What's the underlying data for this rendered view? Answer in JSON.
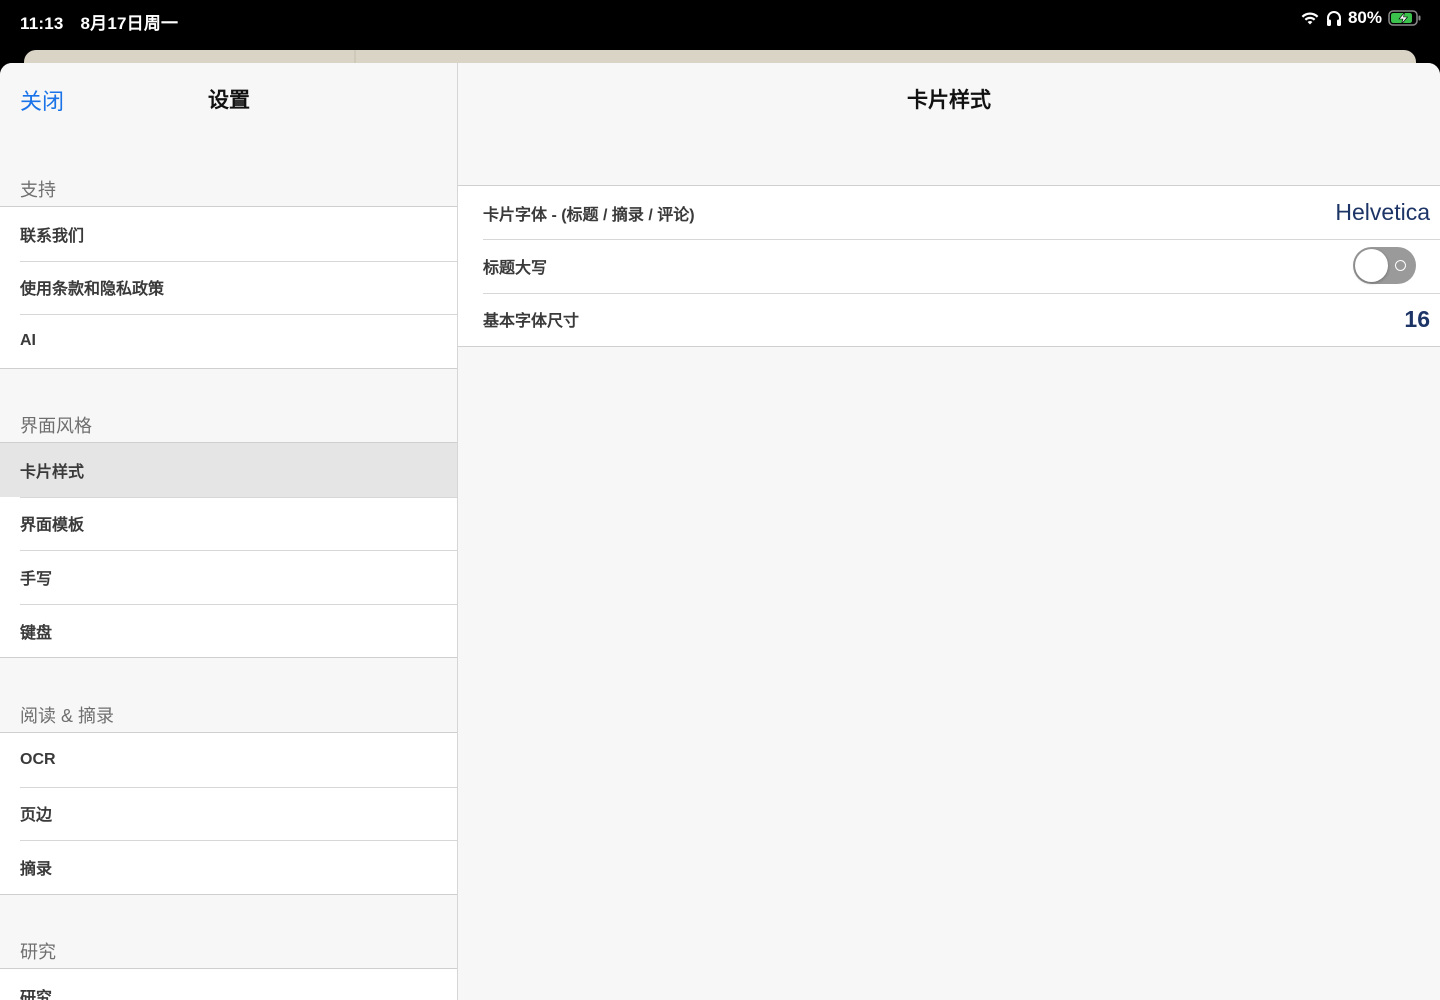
{
  "status_bar": {
    "time": "11:13",
    "date": "8月17日周一",
    "battery": "80%",
    "icons": [
      "wifi-icon",
      "headphones-icon",
      "battery-charging-icon"
    ]
  },
  "sidebar": {
    "close_label": "关闭",
    "title": "设置",
    "sections": [
      {
        "header": "支持",
        "items": [
          "联系我们",
          "使用条款和隐私政策",
          "AI"
        ]
      },
      {
        "header": "界面风格",
        "items": [
          "卡片样式",
          "界面模板",
          "手写",
          "键盘"
        ]
      },
      {
        "header": "阅读 & 摘录",
        "items": [
          "OCR",
          "页边",
          "摘录"
        ]
      },
      {
        "header": "研究",
        "items": [
          "研究"
        ]
      }
    ],
    "selected_item": "卡片样式"
  },
  "detail": {
    "title": "卡片样式",
    "rows": [
      {
        "label": "卡片字体 - (标题 / 摘录 / 评论)",
        "value": "Helvetica"
      },
      {
        "label": "标题大写",
        "toggle_on": false
      },
      {
        "label": "基本字体尺寸",
        "value": "16"
      }
    ]
  },
  "colors": {
    "accent": "#1a73e8",
    "value_text": "#1d3466",
    "toggle_off": "#9a9a9a",
    "selected_row": "#e5e5e5"
  }
}
